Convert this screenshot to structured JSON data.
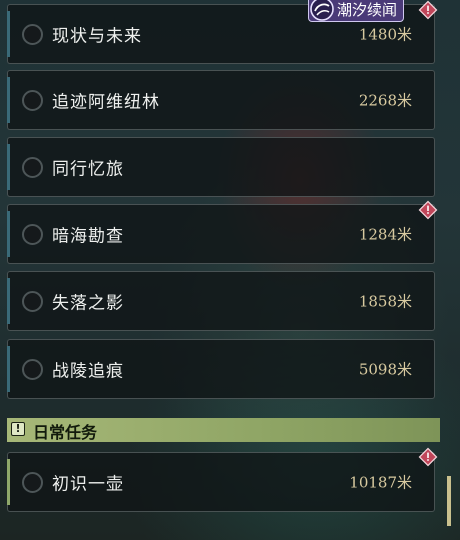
{
  "event_tag": {
    "label": "潮汐续闻",
    "icon": "tide-swirl-icon"
  },
  "quests": [
    {
      "name": "现状与未来",
      "distance": "1480米",
      "alert": true
    },
    {
      "name": "追迹阿维纽林",
      "distance": "2268米",
      "alert": false
    },
    {
      "name": "同行忆旅",
      "distance": "",
      "alert": false
    },
    {
      "name": "暗海勘查",
      "distance": "1284米",
      "alert": true
    },
    {
      "name": "失落之影",
      "distance": "1858米",
      "alert": false
    },
    {
      "name": "战陵追痕",
      "distance": "5098米",
      "alert": false
    }
  ],
  "daily_section": {
    "title": "日常任务",
    "icon": "exclamation-icon",
    "icon_text": "!",
    "quests": [
      {
        "name": "初识一壶",
        "distance": "10187米",
        "alert": true
      }
    ]
  },
  "colors": {
    "alert": "#c0465a",
    "event_tag_bg": "#4a3a78",
    "section_header": "#a7b878",
    "distance_text": "#d8caa0"
  }
}
